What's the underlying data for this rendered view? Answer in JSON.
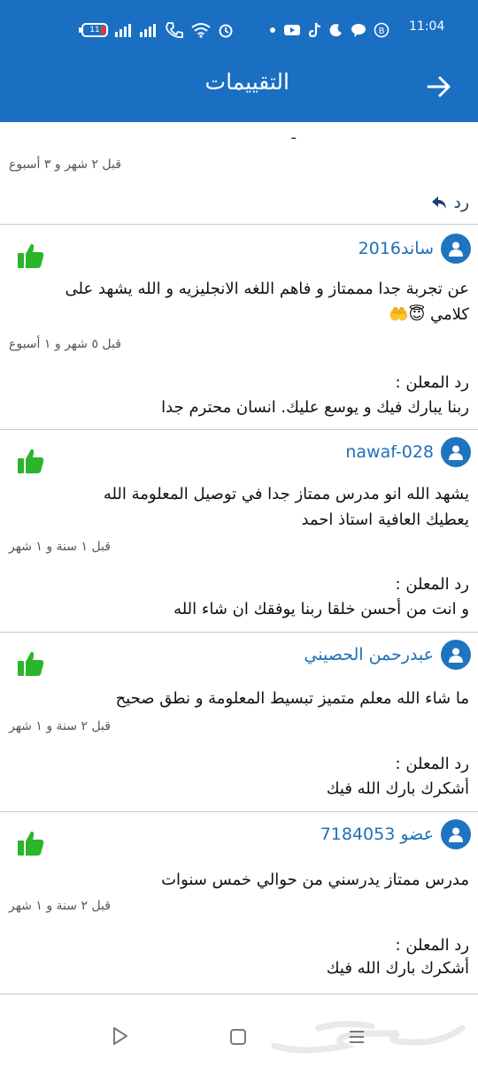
{
  "status_bar": {
    "time": "11:04",
    "battery": "11"
  },
  "header": {
    "title": "التقييمات"
  },
  "top_card": {
    "timestamp": "قبل ٢ شهر و ٣ أسبوع",
    "reply_button": "رد"
  },
  "reviews": [
    {
      "username": "ساند2016",
      "comment_line1": "عن تجربة جدا مممتاز و فاهم اللغه الانجليزيه و الله يشهد على",
      "comment_line2": "كلامي 😇🤲",
      "timestamp": "قبل ٥ شهر و ١ أسبوع",
      "reply_label": "رد المعلن :",
      "reply_text": "ربنا يبارك فيك و يوسع عليك. انسان محترم جدا"
    },
    {
      "username": "nawaf-028",
      "comment_line1": "يشهد الله انو مدرس ممتاز جدا في توصيل المعلومة الله",
      "comment_line2": "يعطيك العافية استاذ احمد",
      "timestamp": "قبل ١ سنة و ١ شهر",
      "reply_label": "رد المعلن :",
      "reply_text": "و انت من أحسن خلقا ربنا يوفقك ان شاء الله"
    },
    {
      "username": "عبدرحمن الحصيني",
      "comment_line1": "ما شاء الله معلم متميز تبسيط المعلومة و نطق صحيح",
      "comment_line2": "",
      "timestamp": "قبل ٢ سنة و ١ شهر",
      "reply_label": "رد المعلن :",
      "reply_text": "أشكرك بارك الله فيك"
    },
    {
      "username": "عضو 7184053",
      "comment_line1": "مدرس ممتاز يدرسني من حوالي خمس سنوات",
      "comment_line2": "",
      "timestamp": "قبل ٢ سنة و ١ شهر",
      "reply_label": "رد المعلن :",
      "reply_text": "أشكرك بارك الله فيك"
    }
  ],
  "colors": {
    "header_bg": "#1a6fc2",
    "username": "#1f6fb8",
    "like_green": "#2bb52b",
    "avatar_bg": "#1f74c0"
  },
  "icons": {
    "back": "arrow-right-icon",
    "like": "thumbs-up-icon",
    "avatar": "user-avatar-icon",
    "reply": "reply-arrow-icon"
  }
}
